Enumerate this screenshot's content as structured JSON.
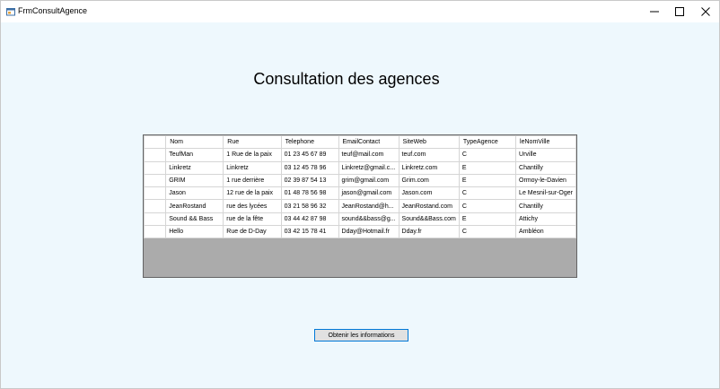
{
  "window": {
    "title": "FrmConsultAgence"
  },
  "heading": "Consultation des agences",
  "grid": {
    "columns": [
      "Nom",
      "Rue",
      "Telephone",
      "EmailContact",
      "SiteWeb",
      "TypeAgence",
      "leNomVille"
    ],
    "rows": [
      [
        "TeufMan",
        "1 Rue de la paix",
        "01 23 45 67 89",
        "teuf@mail.com",
        "teuf.com",
        "C",
        "Urville"
      ],
      [
        "Linkretz",
        "Linkretz",
        "03 12 45 78 96",
        "Linkretz@gmail.c...",
        "Linkretz.com",
        "E",
        "Chantilly"
      ],
      [
        "GRIM",
        "1 rue derrière",
        "02 39 87 54 13",
        "grim@gmail.com",
        "Grim.com",
        "E",
        "Ormoy-le-Davien"
      ],
      [
        "Jason",
        "12 rue de la paix",
        "01 48 78 56 98",
        "jason@gmail.com",
        "Jason.com",
        "C",
        "Le Mesnil-sur-Oger"
      ],
      [
        "JeanRostand",
        "rue des lycées",
        "03 21 58 96 32",
        "JeanRostand@h...",
        "JeanRostand.com",
        "C",
        "Chantilly"
      ],
      [
        "Sound && Bass",
        "rue de la fête",
        "03 44 42 87 98",
        "sound&&bass@g...",
        "Sound&&Bass.com",
        "E",
        "Attichy"
      ],
      [
        "Hello",
        "Rue de D-Day",
        "03 42 15 78 41",
        "Dday@Hotmail.fr",
        "Dday.fr",
        "C",
        "Ambléon"
      ]
    ]
  },
  "button": {
    "label": "Obtenir les informations"
  },
  "icons": {
    "app": "form-app-icon",
    "minimize": "minimize-icon",
    "maximize": "maximize-icon",
    "close": "close-icon"
  },
  "colors": {
    "client_bg": "#eef8fd",
    "grid_empty": "#ababab",
    "button_border": "#0078d7"
  }
}
